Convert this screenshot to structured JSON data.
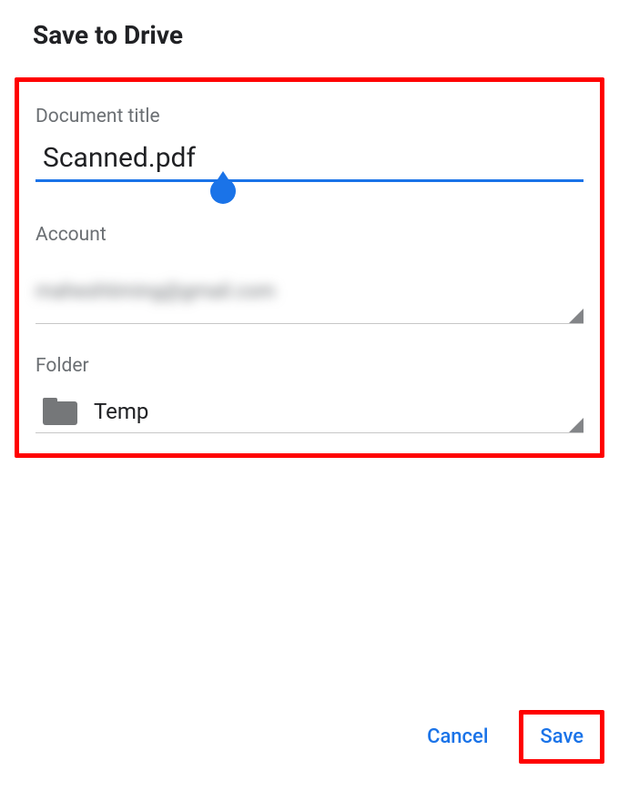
{
  "header": {
    "title": "Save to Drive"
  },
  "form": {
    "title_label": "Document title",
    "title_value": "Scanned.pdf",
    "account_label": "Account",
    "account_value": "maheshtiming@gmail.com",
    "folder_label": "Folder",
    "folder_value": "Temp"
  },
  "footer": {
    "cancel_label": "Cancel",
    "save_label": "Save"
  },
  "colors": {
    "accent": "#1a73e8",
    "highlight": "#ff0000",
    "label": "#6b6f73"
  }
}
